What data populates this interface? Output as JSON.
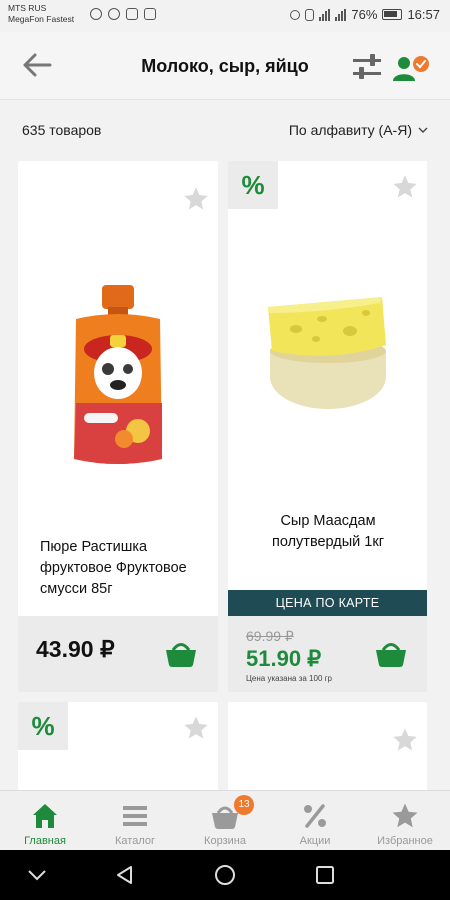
{
  "status_bar": {
    "carrier_line1": "MTS RUS",
    "carrier_line2": "MegaFon Fastest",
    "battery": "76%",
    "time": "16:57"
  },
  "header": {
    "title": "Молоко, сыр, яйцо",
    "back_icon": "arrow-left-icon",
    "filter_icon": "sliders-icon",
    "profile_icon": "user-check-icon"
  },
  "list": {
    "count": "635 товаров",
    "sort_label": "По алфавиту (А-Я)"
  },
  "products": [
    {
      "name": "Пюре Растишка фруктовое Фруктовое смусси 85г",
      "price": "43.90 ₽",
      "discount": false
    },
    {
      "name": "Сыр Маасдам полутвердый 1кг",
      "card_label": "ЦЕНА ПО КАРТЕ",
      "old_price": "69.99 ₽",
      "price": "51.90 ₽",
      "note": "Цена указана за 100 гр",
      "discount": true,
      "discount_badge": "%"
    },
    {
      "discount": true,
      "discount_badge": "%"
    },
    {
      "discount": false
    }
  ],
  "bottom_nav": [
    {
      "label": "Главная",
      "icon": "home-icon",
      "active": true
    },
    {
      "label": "Каталог",
      "icon": "list-icon",
      "active": false
    },
    {
      "label": "Корзина",
      "icon": "basket-icon",
      "active": false,
      "badge": "13"
    },
    {
      "label": "Акции",
      "icon": "percent-icon",
      "active": false
    },
    {
      "label": "Избранное",
      "icon": "star-icon",
      "active": false
    }
  ],
  "colors": {
    "brand_green": "#1e8a3c",
    "accent_orange": "#ef7a2e",
    "card_band": "#1f4b54"
  }
}
